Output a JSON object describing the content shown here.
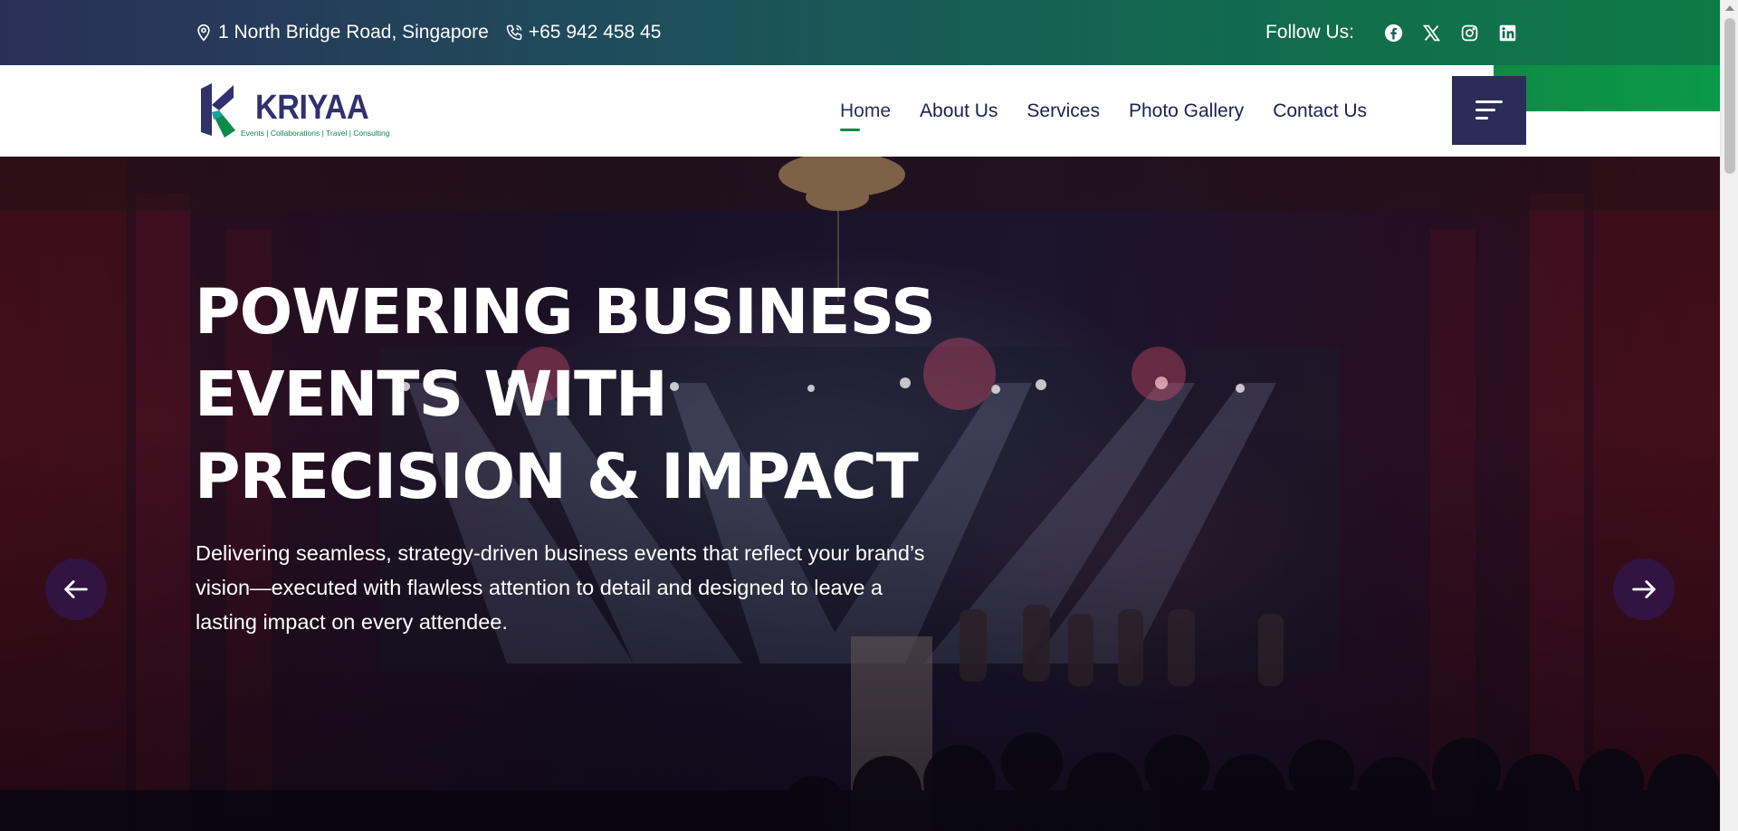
{
  "topbar": {
    "address": "1 North Bridge Road, Singapore",
    "phone": "+65 942 458 45",
    "follow_label": "Follow Us:",
    "social": [
      {
        "icon": "facebook-icon"
      },
      {
        "icon": "x-twitter-icon"
      },
      {
        "icon": "instagram-icon"
      },
      {
        "icon": "linkedin-icon"
      }
    ]
  },
  "logo": {
    "name": "KRIYAA",
    "tagline": "Events | Collaborations | Travel | Consulting"
  },
  "nav": {
    "items": [
      {
        "label": "Home",
        "active": true
      },
      {
        "label": "About Us"
      },
      {
        "label": "Services"
      },
      {
        "label": "Photo Gallery"
      },
      {
        "label": "Contact Us"
      }
    ],
    "menu_icon": "hamburger-menu-icon"
  },
  "hero": {
    "title": "POWERING BUSINESS EVENTS WITH PRECISION & IMPACT",
    "subtitle": "Delivering seamless, strategy-driven business events that reflect your brand’s vision—executed with flawless attention to detail and designed to leave a lasting impact on every attendee.",
    "prev_icon": "arrow-left-icon",
    "next_icon": "arrow-right-icon"
  },
  "colors": {
    "brand_navy": "#2b2c58",
    "brand_green": "#0b8a45",
    "topbar_start": "#2a2f58",
    "topbar_end": "#0f7a45"
  }
}
